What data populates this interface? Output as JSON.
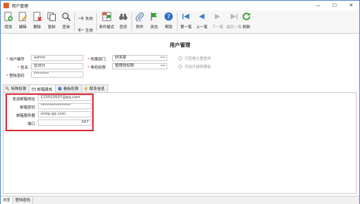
{
  "window": {
    "title": "用户管理",
    "controls": [
      "—",
      "☐",
      "✕"
    ]
  },
  "toolbar": {
    "add": "增加",
    "edit": "编辑",
    "delete": "删除",
    "copy": "复制",
    "query": "查询",
    "invalidate": "失效",
    "valid": "生效",
    "condition_format": "条件格式",
    "find": "查找",
    "attachment": "附件",
    "status": "状态",
    "help": "帮助",
    "first": "第一笔",
    "prev": "上一笔",
    "next": "下一笔",
    "last": "最后一笔",
    "refresh": "刷新"
  },
  "page_title": "用户管理",
  "form": {
    "user_code_label": "用户编号",
    "user_code_value": "admin",
    "name_label": "姓名",
    "name_value": "管理员",
    "password_label": "登陆密码",
    "password_value": "********",
    "dept_label": "所属部门",
    "dept_value": "研发部",
    "role_label": "角色权限",
    "role_value": "管理员权限",
    "check1_label": "可查看位置医师",
    "check2_label": "可经开报表模板"
  },
  "tabs": [
    {
      "label": "特殊权限"
    },
    {
      "label": "邮箱属成"
    },
    {
      "label": "看板权限"
    },
    {
      "label": "联系信息"
    }
  ],
  "email": {
    "sender_label": "发送邮箱地址",
    "sender_value": "123523507@qq.com",
    "password_label": "邮箱密码",
    "password_value": "****************",
    "server_label": "邮箱服务器",
    "server_value": "smtp.qq.com",
    "port_label": "端口",
    "port_value": "587"
  },
  "status_tabs": [
    "浏览",
    "登陆密码"
  ],
  "colors": {
    "accent": "#4a84c4",
    "highlight": "#d9232e",
    "required": "#d9232e"
  }
}
